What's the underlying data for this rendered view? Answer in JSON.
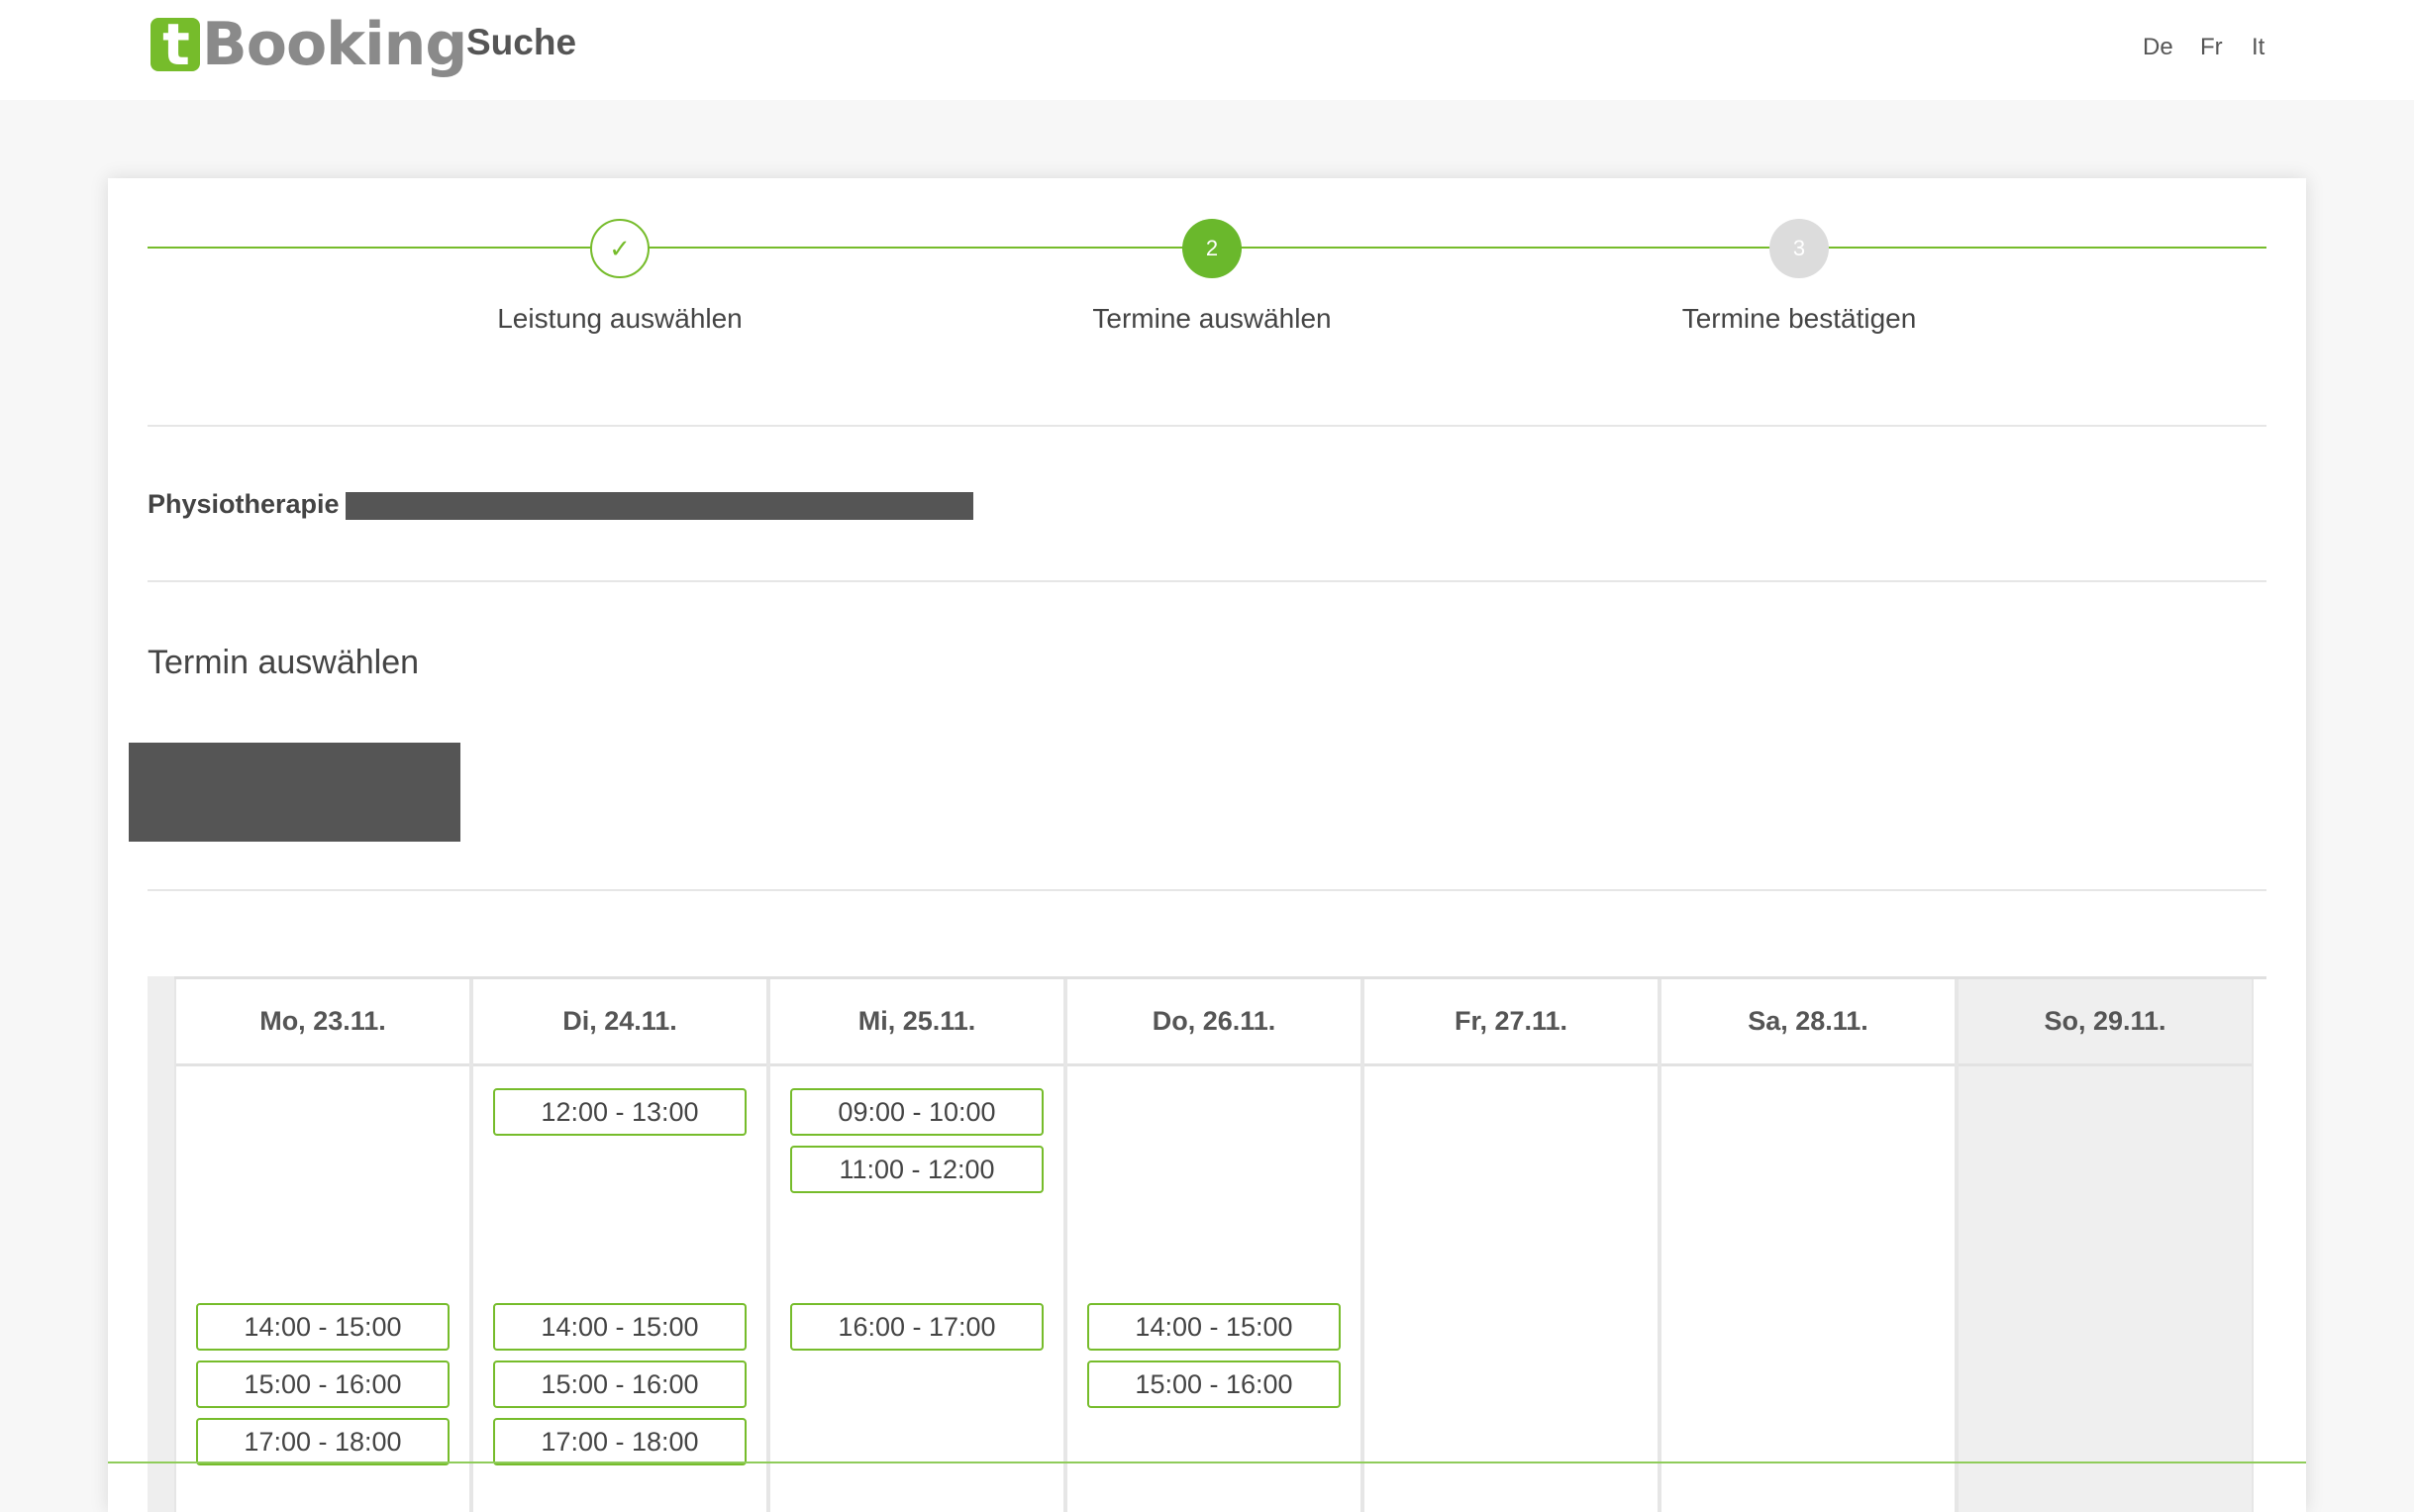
{
  "header": {
    "logo_mark": "t",
    "logo_text": "Booking",
    "nav_title": "Suche",
    "languages": [
      "De",
      "Fr",
      "It"
    ]
  },
  "stepper": {
    "steps": [
      {
        "marker": "✓",
        "label": "Leistung auswählen",
        "state": "done"
      },
      {
        "marker": "2",
        "label": "Termine auswählen",
        "state": "active"
      },
      {
        "marker": "3",
        "label": "Termine bestätigen",
        "state": "pending"
      }
    ]
  },
  "service": {
    "name": "Physiotherapie"
  },
  "section_title": "Termin auswählen",
  "calendar": {
    "days": [
      {
        "label": "Mo, 23.11.",
        "weekend": false,
        "morning": [],
        "afternoon": [
          "14:00 - 15:00",
          "15:00 - 16:00",
          "17:00 - 18:00"
        ]
      },
      {
        "label": "Di, 24.11.",
        "weekend": false,
        "morning": [
          "12:00 - 13:00"
        ],
        "afternoon": [
          "14:00 - 15:00",
          "15:00 - 16:00",
          "17:00 - 18:00"
        ]
      },
      {
        "label": "Mi, 25.11.",
        "weekend": false,
        "morning": [
          "09:00 - 10:00",
          "11:00 - 12:00"
        ],
        "afternoon": [
          "16:00 - 17:00"
        ]
      },
      {
        "label": "Do, 26.11.",
        "weekend": false,
        "morning": [],
        "afternoon": [
          "14:00 - 15:00",
          "15:00 - 16:00"
        ]
      },
      {
        "label": "Fr, 27.11.",
        "weekend": false,
        "morning": [],
        "afternoon": []
      },
      {
        "label": "Sa, 28.11.",
        "weekend": false,
        "morning": [],
        "afternoon": []
      },
      {
        "label": "So, 29.11.",
        "weekend": true,
        "morning": [],
        "afternoon": []
      }
    ]
  },
  "colors": {
    "accent": "#76bc2b",
    "redaction": "#555555",
    "weekend_bg": "#efefef"
  }
}
